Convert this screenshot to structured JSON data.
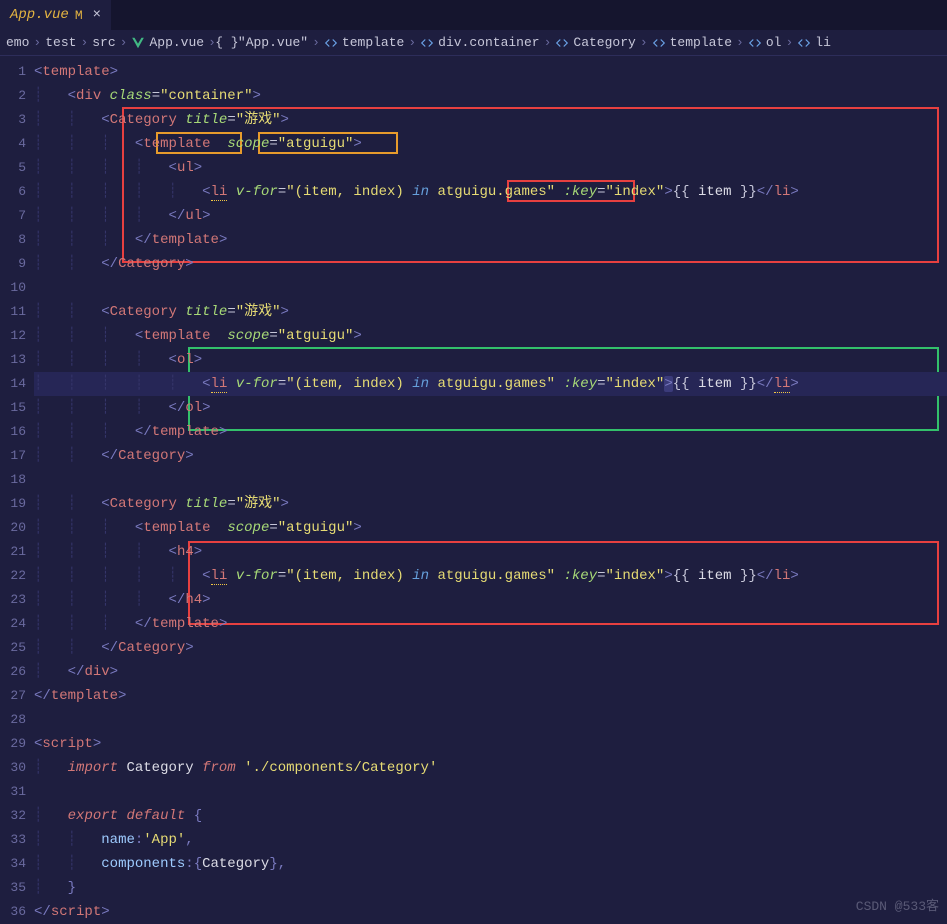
{
  "tab": {
    "name": "App.vue",
    "badge": "M",
    "close": "×"
  },
  "breadcrumb": {
    "items": [
      {
        "label": "emo",
        "icon": ""
      },
      {
        "label": "test",
        "icon": ""
      },
      {
        "label": "src",
        "icon": ""
      },
      {
        "label": "App.vue",
        "icon": "vue"
      },
      {
        "label": "\"App.vue\"",
        "icon": "braces"
      },
      {
        "label": "template",
        "icon": "code"
      },
      {
        "label": "div.container",
        "icon": "code"
      },
      {
        "label": "Category",
        "icon": "code"
      },
      {
        "label": "template",
        "icon": "code"
      },
      {
        "label": "ol",
        "icon": "code"
      },
      {
        "label": "li",
        "icon": "code"
      }
    ]
  },
  "watermark": "CSDN @533客",
  "line_numbers": [
    "1",
    "2",
    "3",
    "4",
    "5",
    "6",
    "7",
    "8",
    "9",
    "10",
    "11",
    "12",
    "13",
    "14",
    "15",
    "16",
    "17",
    "18",
    "19",
    "20",
    "21",
    "22",
    "23",
    "24",
    "25",
    "26",
    "27",
    "28",
    "29",
    "30",
    "31",
    "32",
    "33",
    "34",
    "35",
    "36"
  ],
  "code": {
    "l1": {
      "a": "<",
      "b": "template",
      "c": ">"
    },
    "l2": {
      "a": "<",
      "b": "div",
      "attr": "class",
      "eq": "=",
      "val": "\"container\"",
      "c": ">"
    },
    "l3": {
      "a": "<",
      "b": "Category",
      "attr": "title",
      "eq": "=",
      "val": "\"游戏\"",
      "c": ">"
    },
    "l4": {
      "a": "<",
      "b": "template",
      "sp": "  ",
      "attr": "scope",
      "eq": "=",
      "val": "\"atguigu\"",
      "c": ">"
    },
    "l5": {
      "a": "<",
      "b": "ul",
      "c": ">"
    },
    "l6": {
      "a": "<",
      "b": "li",
      "attr1": "v-for",
      "eq": "=",
      "val1": "\"(item, index)",
      "in": "in",
      "val2": "atguigu.games\"",
      "attr2": ":key",
      "val3": "\"index\"",
      "c": ">",
      "mus1": "{{ ",
      "ident": "item",
      "mus2": " }}",
      "ct1": "</",
      "ct2": "li",
      "ct3": ">"
    },
    "l7": {
      "a": "</",
      "b": "ul",
      "c": ">"
    },
    "l8": {
      "a": "</",
      "b": "template",
      "c": ">"
    },
    "l9": {
      "a": "</",
      "b": "Category",
      "c": ">"
    },
    "l11": {
      "a": "<",
      "b": "Category",
      "attr": "title",
      "eq": "=",
      "val": "\"游戏\"",
      "c": ">"
    },
    "l12": {
      "a": "<",
      "b": "template",
      "sp": "  ",
      "attr": "scope",
      "eq": "=",
      "val": "\"atguigu\"",
      "c": ">"
    },
    "l13": {
      "a": "<",
      "b": "ol",
      "c": ">"
    },
    "l14": {
      "a": "<",
      "b": "li",
      "attr1": "v-for",
      "eq": "=",
      "val1": "\"(item, index)",
      "in": "in",
      "val2": "atguigu.games\"",
      "attr2": ":key",
      "val3": "\"index\"",
      "c": ">",
      "mus1": "{{ ",
      "ident": "item",
      "mus2": " }}",
      "ct1": "</",
      "ct2": "li",
      "ct3": ">"
    },
    "l15": {
      "a": "</",
      "b": "ol",
      "c": ">"
    },
    "l16": {
      "a": "</",
      "b": "template",
      "c": ">"
    },
    "l17": {
      "a": "</",
      "b": "Category",
      "c": ">"
    },
    "l19": {
      "a": "<",
      "b": "Category",
      "attr": "title",
      "eq": "=",
      "val": "\"游戏\"",
      "c": ">"
    },
    "l20": {
      "a": "<",
      "b": "template",
      "sp": "  ",
      "attr": "scope",
      "eq": "=",
      "val": "\"atguigu\"",
      "c": ">"
    },
    "l21": {
      "a": "<",
      "b": "h4",
      "c": ">"
    },
    "l22": {
      "a": "<",
      "b": "li",
      "attr1": "v-for",
      "eq": "=",
      "val1": "\"(item, index)",
      "in": "in",
      "val2": "atguigu.games\"",
      "attr2": ":key",
      "val3": "\"index\"",
      "c": ">",
      "mus1": "{{ ",
      "ident": "item",
      "mus2": " }}",
      "ct1": "</",
      "ct2": "li",
      "ct3": ">"
    },
    "l23": {
      "a": "</",
      "b": "h4",
      "c": ">"
    },
    "l24": {
      "a": "</",
      "b": "template",
      "c": ">"
    },
    "l25": {
      "a": "</",
      "b": "Category",
      "c": ">"
    },
    "l26": {
      "a": "</",
      "b": "div",
      "c": ">"
    },
    "l27": {
      "a": "</",
      "b": "template",
      "c": ">"
    },
    "l29": {
      "a": "<",
      "b": "script",
      "c": ">"
    },
    "l30": {
      "kw1": "import",
      "id": "Category",
      "kw2": "from",
      "str": "'./components/Category'"
    },
    "l32": {
      "kw1": "export",
      "kw2": "default",
      "brace": "{"
    },
    "l33": {
      "name": "name",
      "colon": ":",
      "val": "'App'",
      "comma": ","
    },
    "l34": {
      "name": "components",
      "colon": ":",
      "b1": "{",
      "id": "Category",
      "b2": "}",
      "comma": ","
    },
    "l35": {
      "brace": "}"
    },
    "l36": {
      "a": "</",
      "b": "script",
      "c": ">"
    }
  }
}
